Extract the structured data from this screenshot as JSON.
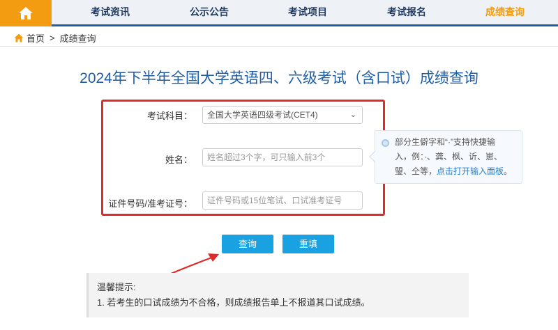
{
  "nav": {
    "items": [
      {
        "label": "考试资讯"
      },
      {
        "label": "公示公告"
      },
      {
        "label": "考试项目"
      },
      {
        "label": "考试报名"
      },
      {
        "label": "成绩查询"
      }
    ],
    "active_index": 4
  },
  "breadcrumb": {
    "home": "首页",
    "separator": ">",
    "current": "成绩查询"
  },
  "page_title": "2024年下半年全国大学英语四、六级考试（含口试）成绩查询",
  "form": {
    "subject_label": "考试科目：",
    "subject_value": "全国大学英语四级考试(CET4)",
    "name_label": "姓名：",
    "name_placeholder": "姓名超过3个字，可只输入前3个",
    "id_label": "证件号码/准考证号：",
    "id_placeholder": "证件号码或15位笔试、口试准考证号"
  },
  "tip": {
    "line1": "部分生僻字和“·”支持快捷输",
    "line2": "入，例：·、龚、枫、䜣、崽、",
    "line3_prefix": "琞、仝等，",
    "line3_link": "点击打开输入面板",
    "line3_suffix": "。"
  },
  "buttons": {
    "query": "查询",
    "reset": "重填"
  },
  "notice": {
    "title": "温馨提示:",
    "item1": "1. 若考生的口试成绩为不合格，则成绩报告单上不报道其口试成绩。"
  },
  "colors": {
    "brand_blue": "#1f5fa5",
    "accent_orange": "#f39c12",
    "button_blue": "#1aa1e1",
    "highlight_red": "#e02b2b"
  }
}
